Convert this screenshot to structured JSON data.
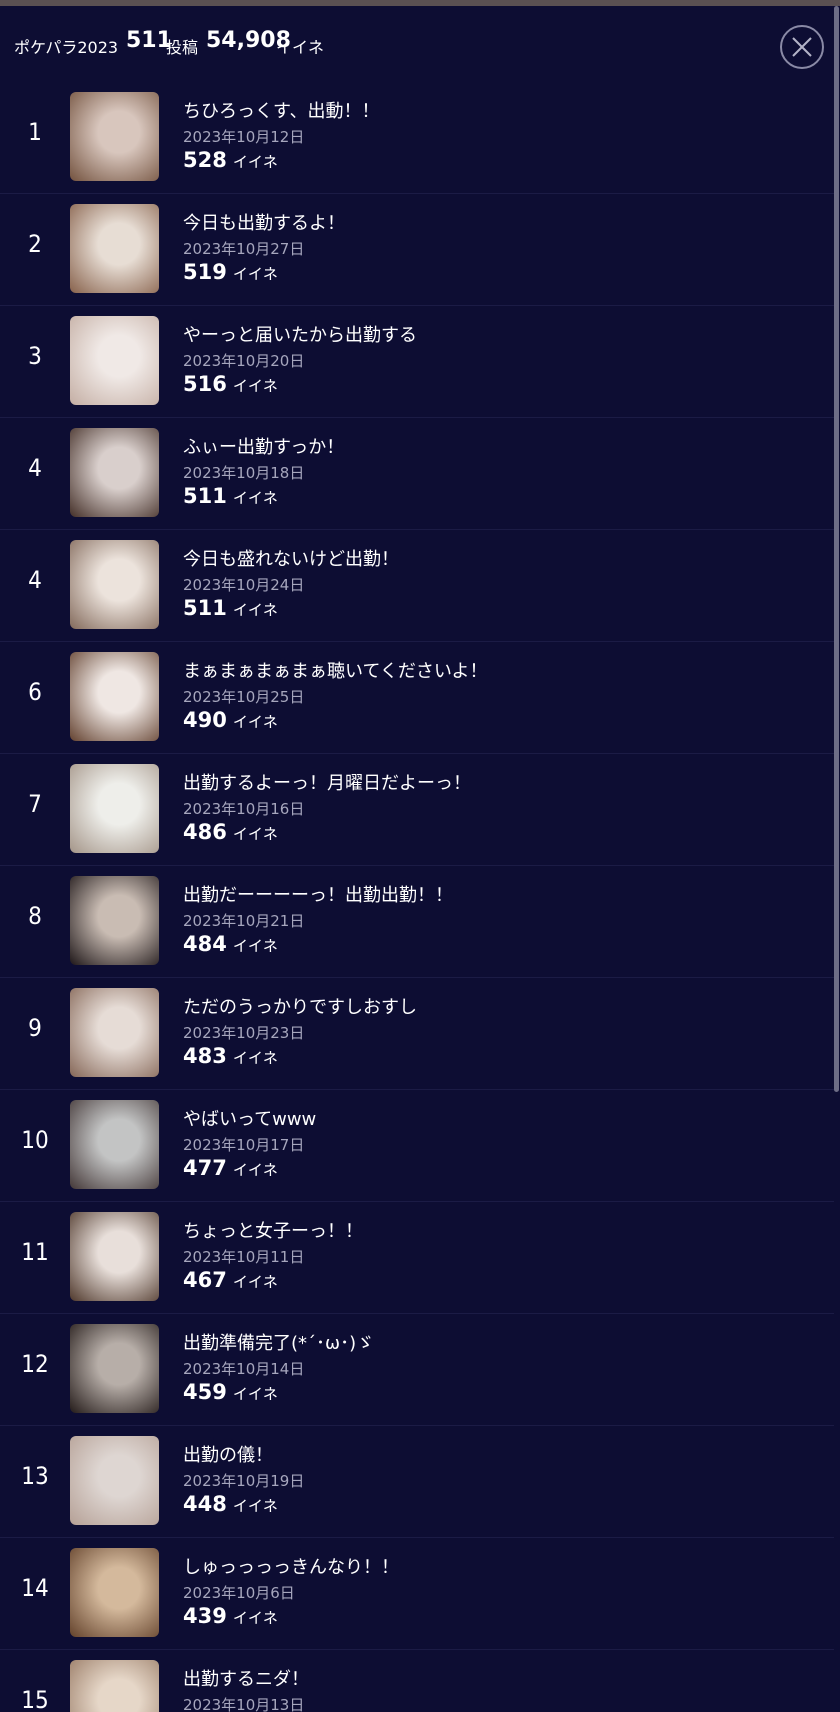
{
  "header": {
    "title": "ポケパラ2023",
    "posts_count": "511",
    "posts_unit": "投稿",
    "likes_total": "54,908",
    "likes_unit": "イイネ"
  },
  "items": [
    {
      "rank": "1",
      "title": "ちひろっくす、出動！！",
      "date": "2023年10月12日",
      "likes": "528",
      "likes_unit": "イイネ",
      "thumb": [
        "#d8c6bd",
        "#7a5a47"
      ]
    },
    {
      "rank": "2",
      "title": "今日も出勤するよ！",
      "date": "2023年10月27日",
      "likes": "519",
      "likes_unit": "イイネ",
      "thumb": [
        "#e7ddd4",
        "#8e6a55"
      ]
    },
    {
      "rank": "3",
      "title": "やーっと届いたから出勤する",
      "date": "2023年10月20日",
      "likes": "516",
      "likes_unit": "イイネ",
      "thumb": [
        "#f0e9e6",
        "#c7b2a8"
      ]
    },
    {
      "rank": "4",
      "title": "ふぃー出勤すっか！",
      "date": "2023年10月18日",
      "likes": "511",
      "likes_unit": "イイネ",
      "thumb": [
        "#d9cfcc",
        "#4e3a33"
      ]
    },
    {
      "rank": "4",
      "title": "今日も盛れないけど出勤！",
      "date": "2023年10月24日",
      "likes": "511",
      "likes_unit": "イイネ",
      "thumb": [
        "#ece3dc",
        "#8a7264"
      ]
    },
    {
      "rank": "6",
      "title": "まぁまぁまぁまぁ聴いてくださいよ！",
      "date": "2023年10月25日",
      "likes": "490",
      "likes_unit": "イイネ",
      "thumb": [
        "#efe7e3",
        "#6d4d3c"
      ]
    },
    {
      "rank": "7",
      "title": "出勤するよーっ！月曜日だよーっ！",
      "date": "2023年10月16日",
      "likes": "486",
      "likes_unit": "イイネ",
      "thumb": [
        "#eeeeea",
        "#a99b8f"
      ]
    },
    {
      "rank": "8",
      "title": "出勤だーーーーっ！出勤出勤！！",
      "date": "2023年10月21日",
      "likes": "484",
      "likes_unit": "イイネ",
      "thumb": [
        "#c9bcb3",
        "#2a2223"
      ]
    },
    {
      "rank": "9",
      "title": "ただのうっかりですしおすし",
      "date": "2023年10月23日",
      "likes": "483",
      "likes_unit": "イイネ",
      "thumb": [
        "#e6dcd6",
        "#8c6f60"
      ]
    },
    {
      "rank": "10",
      "title": "やばいってwww",
      "date": "2023年10月17日",
      "likes": "477",
      "likes_unit": "イイネ",
      "thumb": [
        "#c3c4c4",
        "#4c4141"
      ]
    },
    {
      "rank": "11",
      "title": "ちょっと女子ーっ！！",
      "date": "2023年10月11日",
      "likes": "467",
      "likes_unit": "イイネ",
      "thumb": [
        "#e8dfda",
        "#5a4438"
      ]
    },
    {
      "rank": "12",
      "title": "出勤準備完了(*´･ω･)ゞ",
      "date": "2023年10月14日",
      "likes": "459",
      "likes_unit": "イイネ",
      "thumb": [
        "#b7aea8",
        "#2e2523"
      ]
    },
    {
      "rank": "13",
      "title": "出勤の儀！",
      "date": "2023年10月19日",
      "likes": "448",
      "likes_unit": "イイネ",
      "thumb": [
        "#ded6d2",
        "#b8a49a"
      ]
    },
    {
      "rank": "14",
      "title": "しゅっっっっきんなり！！",
      "date": "2023年10月6日",
      "likes": "439",
      "likes_unit": "イイネ",
      "thumb": [
        "#d4b99c",
        "#6b4a33"
      ]
    },
    {
      "rank": "15",
      "title": "出勤するニダ！",
      "date": "2023年10月13日",
      "likes": "",
      "likes_unit": "",
      "thumb": [
        "#e6d7c8",
        "#9d806b"
      ]
    }
  ]
}
